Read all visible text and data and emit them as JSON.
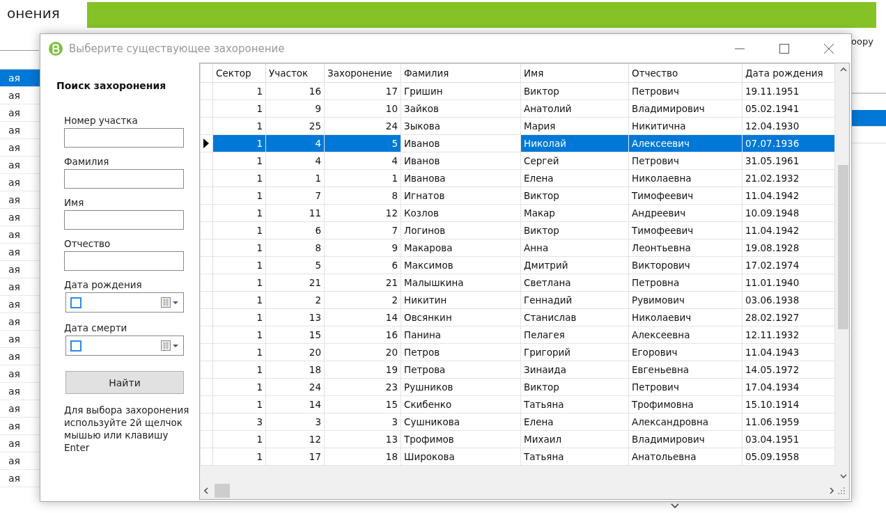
{
  "app": {
    "title": "онения",
    "list_items": [
      {
        "text": "ая",
        "selected": true
      },
      {
        "text": "ая",
        "selected": false
      },
      {
        "text": "ая",
        "selected": false
      },
      {
        "text": "ая",
        "selected": false
      },
      {
        "text": "ая",
        "selected": false
      },
      {
        "text": "ая",
        "selected": false
      },
      {
        "text": "ая",
        "selected": false
      },
      {
        "text": "ая",
        "selected": false
      },
      {
        "text": "ая",
        "selected": false
      },
      {
        "text": "ая",
        "selected": false
      },
      {
        "text": "ая",
        "selected": false
      },
      {
        "text": "ая",
        "selected": false
      },
      {
        "text": "ая",
        "selected": false
      },
      {
        "text": "ая",
        "selected": false
      },
      {
        "text": "ая",
        "selected": false
      },
      {
        "text": "ая",
        "selected": false
      },
      {
        "text": "ая",
        "selected": false
      },
      {
        "text": "ая",
        "selected": false
      },
      {
        "text": "ая",
        "selected": false
      },
      {
        "text": "ая",
        "selected": false
      },
      {
        "text": "ая",
        "selected": false
      },
      {
        "text": "ая",
        "selected": false
      },
      {
        "text": "ая",
        "selected": false
      },
      {
        "text": "ая",
        "selected": false
      }
    ],
    "right_label": "оору",
    "right_rows": [
      {
        "selected": true
      },
      {
        "selected": false
      }
    ]
  },
  "dialog": {
    "title": "Выберите существующее захоронение",
    "search": {
      "heading": "Поиск захоронения",
      "fields": [
        {
          "label": "Номер участка",
          "kind": "text"
        },
        {
          "label": "Фамилия",
          "kind": "text"
        },
        {
          "label": "Имя",
          "kind": "text"
        },
        {
          "label": "Отчество",
          "kind": "text"
        },
        {
          "label": "Дата рождения",
          "kind": "date",
          "checked": false
        },
        {
          "label": "Дата смерти",
          "kind": "date",
          "checked": false
        }
      ],
      "button": "Найти",
      "hint": "Для выбора захоронения используйте 2й щелчок мышью или клавишу Enter"
    },
    "table": {
      "columns": [
        {
          "label": "Сектор",
          "kind": "number",
          "current": false
        },
        {
          "label": "Участок",
          "kind": "number",
          "current": false
        },
        {
          "label": "Захоронение",
          "kind": "number",
          "current": false
        },
        {
          "label": "Фамилия",
          "kind": "text",
          "current": true
        },
        {
          "label": "Имя",
          "kind": "text",
          "current": false
        },
        {
          "label": "Отчество",
          "kind": "text",
          "current": false
        },
        {
          "label": "Дата рождения",
          "kind": "text",
          "current": false
        }
      ],
      "rows": [
        {
          "cells": [
            "1",
            "16",
            "17",
            "Гришин",
            "Виктор",
            "Петрович",
            "19.11.1951"
          ],
          "selected": false
        },
        {
          "cells": [
            "1",
            "9",
            "10",
            "Зайков",
            "Анатолий",
            "Владимирович",
            "05.02.1941"
          ],
          "selected": false
        },
        {
          "cells": [
            "1",
            "25",
            "24",
            "Зыкова",
            "Мария",
            "Никитична",
            "12.04.1930"
          ],
          "selected": false
        },
        {
          "cells": [
            "1",
            "4",
            "5",
            "Иванов",
            "Николай",
            "Алексеевич",
            "07.07.1936"
          ],
          "selected": true
        },
        {
          "cells": [
            "1",
            "4",
            "4",
            "Иванов",
            "Сергей",
            "Петрович",
            "31.05.1961"
          ],
          "selected": false
        },
        {
          "cells": [
            "1",
            "1",
            "1",
            "Иванова",
            "Елена",
            "Николаевна",
            "21.02.1932"
          ],
          "selected": false
        },
        {
          "cells": [
            "1",
            "7",
            "8",
            "Игнатов",
            "Виктор",
            "Тимофеевич",
            "11.04.1942"
          ],
          "selected": false
        },
        {
          "cells": [
            "1",
            "11",
            "12",
            "Козлов",
            "Макар",
            "Андреевич",
            "10.09.1948"
          ],
          "selected": false
        },
        {
          "cells": [
            "1",
            "6",
            "7",
            "Логинов",
            "Виктор",
            "Тимофеевич",
            "11.04.1942"
          ],
          "selected": false
        },
        {
          "cells": [
            "1",
            "8",
            "9",
            "Макарова",
            "Анна",
            "Леонтьевна",
            "19.08.1928"
          ],
          "selected": false
        },
        {
          "cells": [
            "1",
            "5",
            "6",
            "Максимов",
            "Дмитрий",
            "Викторович",
            "17.02.1974"
          ],
          "selected": false
        },
        {
          "cells": [
            "1",
            "21",
            "21",
            "Малышкина",
            "Светлана",
            "Петровна",
            "11.01.1940"
          ],
          "selected": false
        },
        {
          "cells": [
            "1",
            "2",
            "2",
            "Никитин",
            "Геннадий",
            "Рувимович",
            "03.06.1938"
          ],
          "selected": false
        },
        {
          "cells": [
            "1",
            "13",
            "14",
            "Овсянкин",
            "Станислав",
            "Николаевич",
            "28.02.1927"
          ],
          "selected": false
        },
        {
          "cells": [
            "1",
            "15",
            "16",
            "Панина",
            "Пелагея",
            "Алексеевна",
            "12.11.1932"
          ],
          "selected": false
        },
        {
          "cells": [
            "1",
            "20",
            "20",
            "Петров",
            "Григорий",
            "Егорович",
            "11.04.1943"
          ],
          "selected": false
        },
        {
          "cells": [
            "1",
            "18",
            "19",
            "Петрова",
            "Зинаида",
            "Евгеньевна",
            "14.05.1972"
          ],
          "selected": false
        },
        {
          "cells": [
            "1",
            "24",
            "23",
            "Рушников",
            "Виктор",
            "Петрович",
            "17.04.1934"
          ],
          "selected": false
        },
        {
          "cells": [
            "1",
            "14",
            "15",
            "Скибенко",
            "Татьяна",
            "Трофимовна",
            "15.10.1914"
          ],
          "selected": false
        },
        {
          "cells": [
            "3",
            "3",
            "3",
            "Сушникова",
            "Елена",
            "Александровна",
            "11.06.1959"
          ],
          "selected": false
        },
        {
          "cells": [
            "1",
            "12",
            "13",
            "Трофимов",
            "Михаил",
            "Владимирович",
            "03.04.1951"
          ],
          "selected": false
        },
        {
          "cells": [
            "1",
            "17",
            "18",
            "Широкова",
            "Татьяна",
            "Анатольевна",
            "05.09.1958"
          ],
          "selected": false
        }
      ]
    }
  }
}
